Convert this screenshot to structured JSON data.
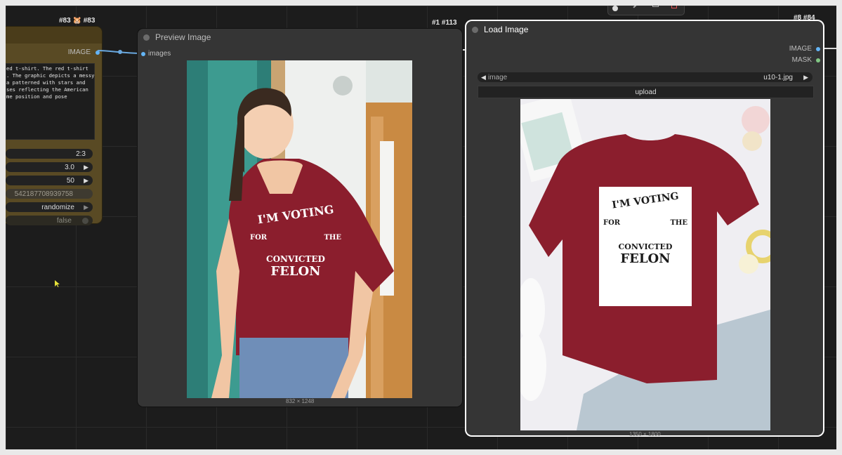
{
  "left_node": {
    "badge": "#83 🐹 #83",
    "output_label": "IMAGE",
    "prompt_lines": [
      "ed t-shirt. The red t-shirt",
      ". The graphic depicts a messy",
      "a patterned with stars and",
      "ses reflecting the American",
      "me position and pose"
    ],
    "widgets": {
      "aspect": "2:3",
      "cfg": "3.0",
      "steps": "50",
      "seed": "542187708939758",
      "control": "randomize",
      "bool": "false"
    },
    "arrow_glyph": "▶"
  },
  "preview_node": {
    "badge": "#1 #113",
    "title": "Preview Image",
    "input_label": "images",
    "image_size": "832 × 1248",
    "shirt_text": {
      "line1": "I'M VOTING",
      "line2": "FOR",
      "line3": "THE",
      "line4": "CONVICTED",
      "line5": "FELON"
    }
  },
  "load_node": {
    "badge": "#8 #84",
    "title": "Load Image",
    "output_image": "IMAGE",
    "output_mask": "MASK",
    "image_widget_label": "image",
    "image_widget_value": "u10-1.jpg",
    "upload_label": "upload",
    "image_size": "1350 × 1800",
    "arrow_left": "◀",
    "arrow_right": "▶",
    "shirt_text": {
      "line1": "I'M VOTING",
      "line2": "FOR",
      "line3": "THE",
      "line4": "CONVICTED",
      "line5": "FELON"
    }
  },
  "colors": {
    "canvas": "#1c1c1c",
    "node_bg": "#353535",
    "selected_border": "#ffffff",
    "image_socket": "#64b5f6",
    "mask_socket": "#81c784",
    "left_node_bg": "#594a24",
    "shirt_red": "#8b1e2d"
  }
}
